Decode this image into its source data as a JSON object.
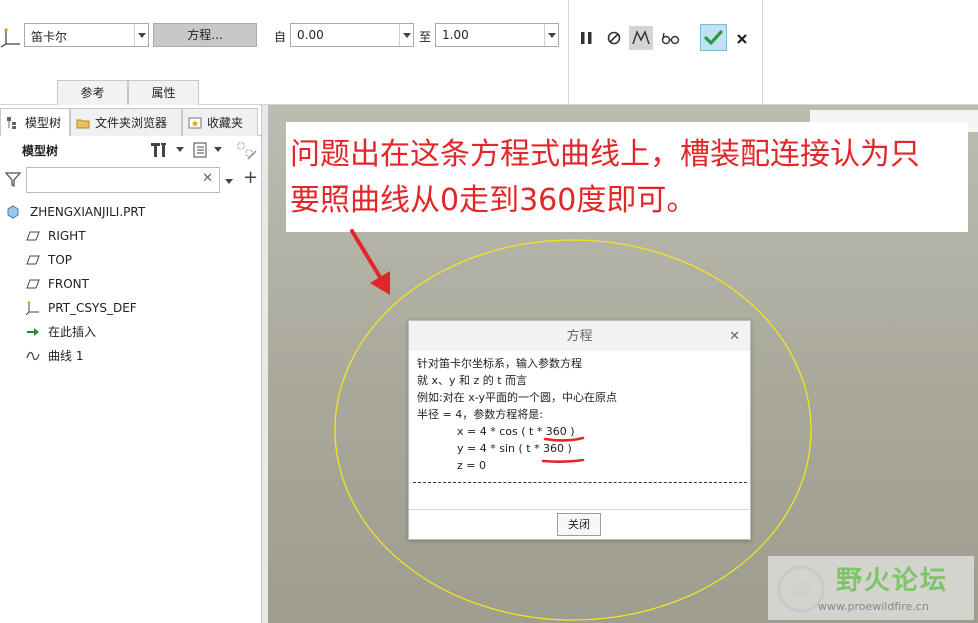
{
  "ribbon": {
    "coord_type": "笛卡尔",
    "equation_button": "方程...",
    "from_label": "自",
    "from_value": "0.00",
    "to_label": "至",
    "to_value": "1.00",
    "tabs": [
      "参考",
      "属性"
    ]
  },
  "panel": {
    "tabs": [
      "模型树",
      "文件夹浏览器",
      "收藏夹"
    ],
    "tree_header": "模型树",
    "filter_placeholder": "",
    "items": [
      "ZHENGXIANJILI.PRT",
      "RIGHT",
      "TOP",
      "FRONT",
      "PRT_CSYS_DEF",
      "在此插入",
      "曲线 1"
    ]
  },
  "callout": {
    "line1": "问题出在这条方程式曲线上，槽装配连接认为只",
    "line2": "要照曲线从0走到360度即可。"
  },
  "dialog": {
    "title": "方程",
    "lines": [
      "针对笛卡尔坐标系，输入参数方程",
      "就 x、y 和 z 的 t 而言",
      "例如:对在 x-y平面的一个圆，中心在原点",
      "半径 = 4，参数方程将是:"
    ],
    "eq_x": "x = 4 * cos ( t * 360 )",
    "eq_y": "y = 4 * sin ( t * 360 )",
    "eq_z": "z = 0",
    "close_button": "关闭"
  },
  "watermark": {
    "title": "野火论坛",
    "url": "www.proewildfire.cn"
  },
  "colors": {
    "callout_text": "#e3262a",
    "curve": "#f2e51c",
    "annotation": "#e3262a",
    "ok_green": "#2a9a3a"
  }
}
